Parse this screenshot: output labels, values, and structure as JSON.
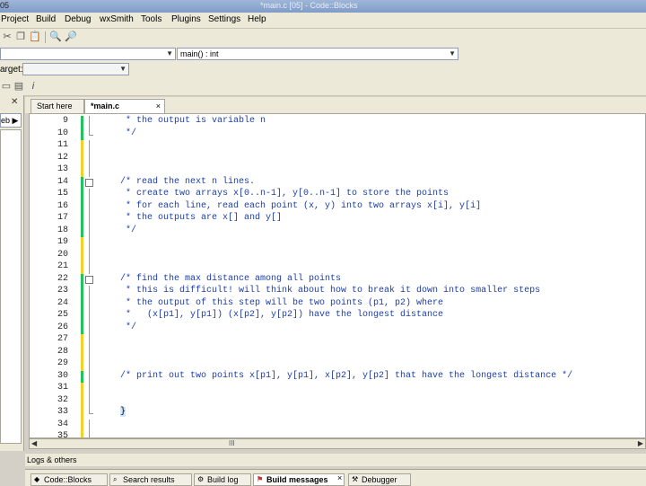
{
  "window": {
    "app_version": "05",
    "title": "*main.c [05] - Code::Blocks"
  },
  "menu": [
    "Project",
    "Build",
    "Debug",
    "wxSmith",
    "Tools",
    "Plugins",
    "Settings",
    "Help"
  ],
  "symbols": {
    "scope_value": "",
    "function_value": "main() : int"
  },
  "build_target": {
    "label": "arget:",
    "value": ""
  },
  "left_panel": {
    "tab_label": "eb"
  },
  "editor_tabs": [
    {
      "label": "Start here",
      "active": false
    },
    {
      "label": "*main.c",
      "active": true,
      "close": "×"
    }
  ],
  "code_lines": [
    {
      "n": "9",
      "text": " * the output is variable n"
    },
    {
      "n": "10",
      "text": " */"
    },
    {
      "n": "11",
      "text": ""
    },
    {
      "n": "12",
      "text": ""
    },
    {
      "n": "13",
      "text": ""
    },
    {
      "n": "14",
      "text": "/* read the next n lines."
    },
    {
      "n": "15",
      "text": " * create two arrays x[0..n-1], y[0..n-1] to store the points"
    },
    {
      "n": "16",
      "text": " * for each line, read each point (x, y) into two arrays x[i], y[i]"
    },
    {
      "n": "17",
      "text": " * the outputs are x[] and y[]"
    },
    {
      "n": "18",
      "text": " */"
    },
    {
      "n": "19",
      "text": ""
    },
    {
      "n": "20",
      "text": ""
    },
    {
      "n": "21",
      "text": ""
    },
    {
      "n": "22",
      "text": "/* find the max distance among all points"
    },
    {
      "n": "23",
      "text": " * this is difficult! will think about how to break it down into smaller steps"
    },
    {
      "n": "24",
      "text": " * the output of this step will be two points (p1, p2) where"
    },
    {
      "n": "25",
      "text": " *   (x[p1], y[p1]) (x[p2], y[p2]) have the longest distance"
    },
    {
      "n": "26",
      "text": " */"
    },
    {
      "n": "27",
      "text": ""
    },
    {
      "n": "28",
      "text": ""
    },
    {
      "n": "29",
      "text": ""
    },
    {
      "n": "30",
      "text": "/* print out two points x[p1], y[p1], x[p2], y[p2] that have the longest distance */"
    },
    {
      "n": "31",
      "text": ""
    },
    {
      "n": "32",
      "text": ""
    },
    {
      "n": "33",
      "text": "}"
    },
    {
      "n": "34",
      "text": ""
    },
    {
      "n": "35",
      "text": ""
    }
  ],
  "change_markers": {
    "green_lines": [
      "9",
      "10",
      "14",
      "15",
      "16",
      "17",
      "18",
      "22",
      "23",
      "24",
      "25",
      "26",
      "30"
    ],
    "yellow_lines": [
      "11",
      "12",
      "13",
      "19",
      "20",
      "21",
      "27",
      "28",
      "29",
      "31",
      "32",
      "33",
      "34",
      "35"
    ]
  },
  "fold_start_lines": [
    "14",
    "22"
  ],
  "colors": {
    "green_marker": "#22c35e",
    "yellow_marker": "#f2d22e",
    "comment": "#1c3ea8"
  },
  "hscroll": {
    "grip": "III"
  },
  "logs": {
    "header": "Logs & others",
    "tabs": [
      {
        "label": "Code::Blocks",
        "active": false
      },
      {
        "label": "Search results",
        "active": false
      },
      {
        "label": "Build log",
        "active": false
      },
      {
        "label": "Build messages",
        "active": true
      },
      {
        "label": "Debugger",
        "active": false
      }
    ]
  }
}
